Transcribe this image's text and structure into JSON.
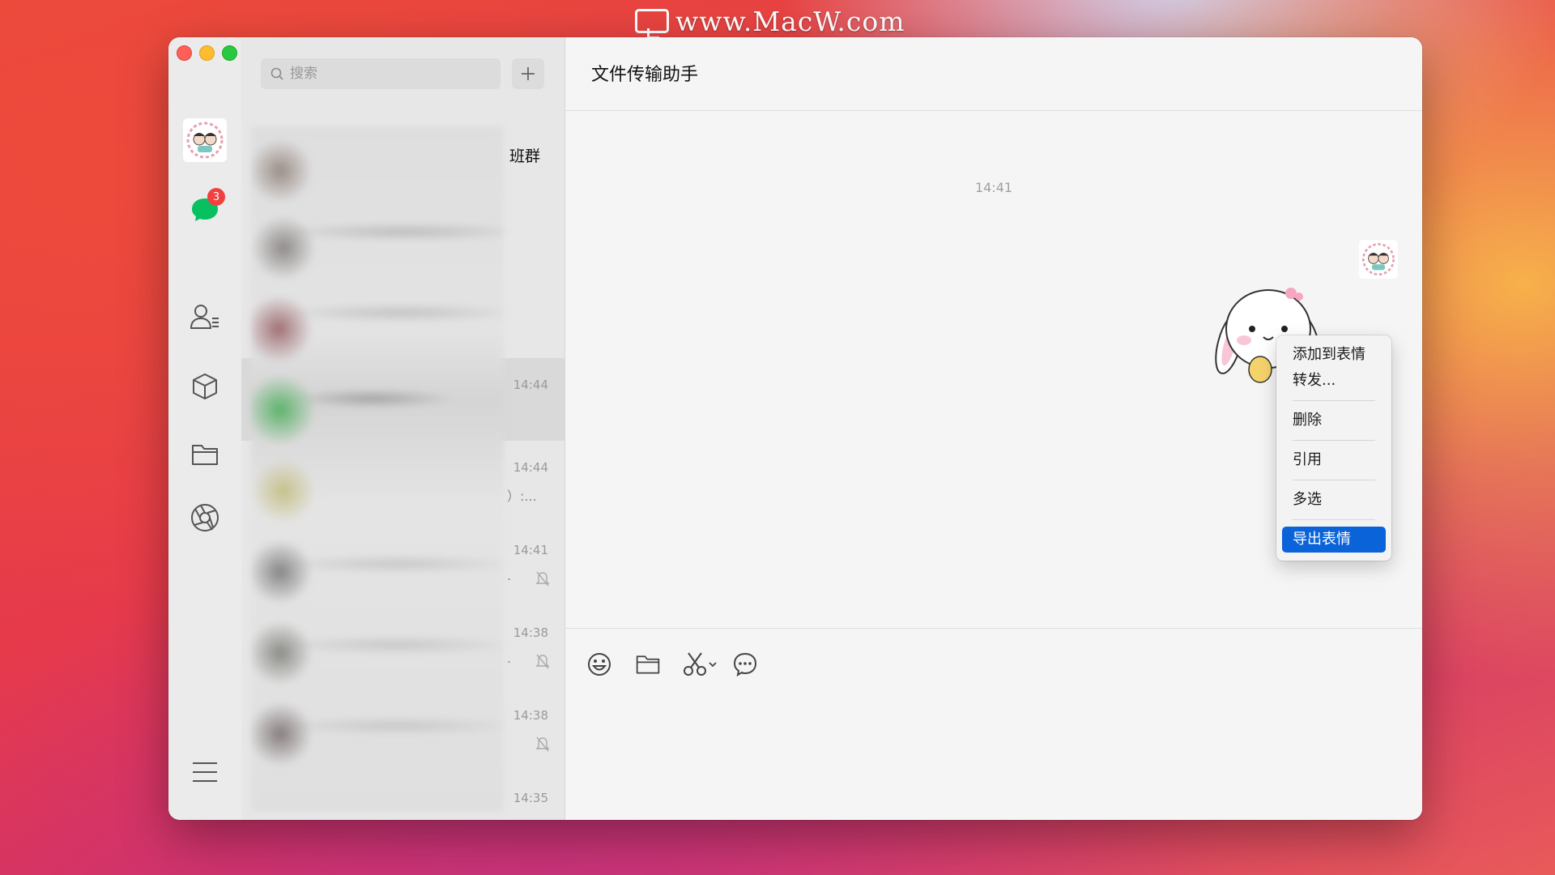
{
  "watermark": {
    "text": "www.MacW.com"
  },
  "window": {
    "traffic_lights": [
      "close",
      "minimize",
      "maximize"
    ]
  },
  "nav": {
    "unread_badge": "3",
    "icons": [
      "avatar",
      "chat-bubble-icon",
      "contacts-icon",
      "cube-icon",
      "folder-icon",
      "aperture-icon",
      "menu-icon"
    ]
  },
  "search": {
    "placeholder": "搜索",
    "add_label": "+"
  },
  "chat_list": {
    "items": [
      {
        "time": "",
        "partial_name": "班群",
        "muted": false,
        "selected": false,
        "preview_tail": ""
      },
      {
        "time": "",
        "partial_name": "",
        "muted": false,
        "selected": false,
        "preview_tail": ""
      },
      {
        "time": "",
        "partial_name": "",
        "muted": false,
        "selected": false,
        "preview_tail": ""
      },
      {
        "time": "14:44",
        "partial_name": "",
        "muted": false,
        "selected": true,
        "preview_tail": ""
      },
      {
        "time": "14:44",
        "partial_name": "",
        "muted": false,
        "selected": false,
        "preview_tail": "）:..."
      },
      {
        "time": "14:41",
        "partial_name": "",
        "muted": true,
        "selected": false,
        "preview_tail": "."
      },
      {
        "time": "14:38",
        "partial_name": "",
        "muted": true,
        "selected": false,
        "preview_tail": "."
      },
      {
        "time": "14:38",
        "partial_name": "",
        "muted": true,
        "selected": false,
        "preview_tail": ""
      },
      {
        "time": "14:35",
        "partial_name": "",
        "muted": false,
        "selected": false,
        "preview_tail": ""
      }
    ]
  },
  "conversation": {
    "title": "文件传输助手",
    "timestamp": "14:41"
  },
  "context_menu": {
    "items": [
      {
        "label": "添加到表情"
      },
      {
        "label": "转发..."
      },
      {
        "label": "删除"
      },
      {
        "label": "引用"
      },
      {
        "label": "多选"
      },
      {
        "label": "导出表情"
      }
    ],
    "active_index": 5
  },
  "toolbar": {
    "icons": [
      "emoji-icon",
      "folder-icon",
      "scissors-icon",
      "chat-history-icon"
    ]
  },
  "colors": {
    "accent_selection": "#0a63d8",
    "wechat_green": "#07c160",
    "badge_red": "#f04040"
  }
}
